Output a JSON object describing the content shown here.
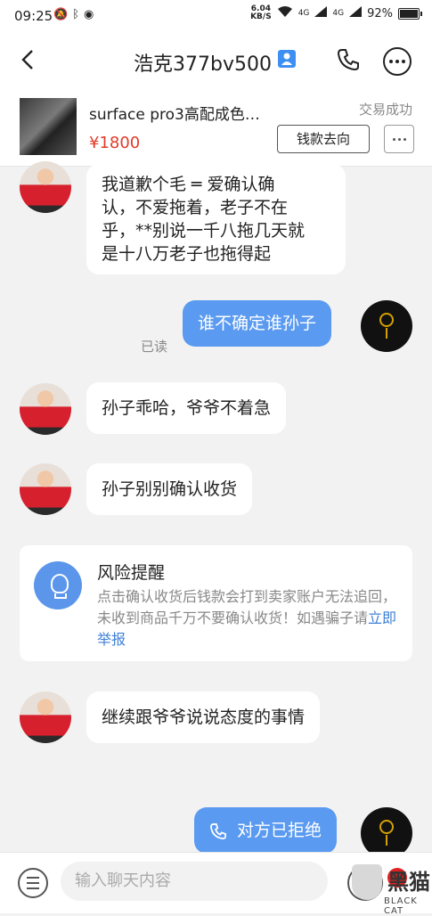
{
  "status_bar": {
    "time": "09:25",
    "net_speed_value": "6.04",
    "net_speed_unit": "KB/S",
    "signal_1": "4G",
    "signal_2": "4G",
    "battery": "92%",
    "battery_level": 0.92
  },
  "nav": {
    "title": "浩克377bv500"
  },
  "product": {
    "title": "surface pro3高配成色…",
    "price": "¥1800",
    "status": "交易成功",
    "money_button": "钱款去向"
  },
  "messages": {
    "m1": {
      "line1": "我道歉个毛  ═  爱确认确",
      "line2": "认，不爱拖着，老子不在",
      "line3": "乎，**别说一千八拖几天就",
      "line4": "是十八万老子也拖得起"
    },
    "m2": "谁不确定谁孙子",
    "read_label": "已读",
    "m3": "孙子乖哈，爷爷不着急",
    "m4": "孙子别别确认收货",
    "m5": "继续跟爷爷说说态度的事情",
    "m6": "对方已拒绝"
  },
  "risk": {
    "title": "风险提醒",
    "body": "点击确认收货后钱款会打到卖家账户无法追回，未收到商品千万不要确认收货！如遇骗子请",
    "link": "立即举报"
  },
  "input": {
    "placeholder": "输入聊天内容"
  },
  "watermark": {
    "cn": "黑猫",
    "en": "BLACK CAT"
  },
  "colors": {
    "accent_blue": "#5a9af0",
    "price_red": "#e23b2a"
  }
}
